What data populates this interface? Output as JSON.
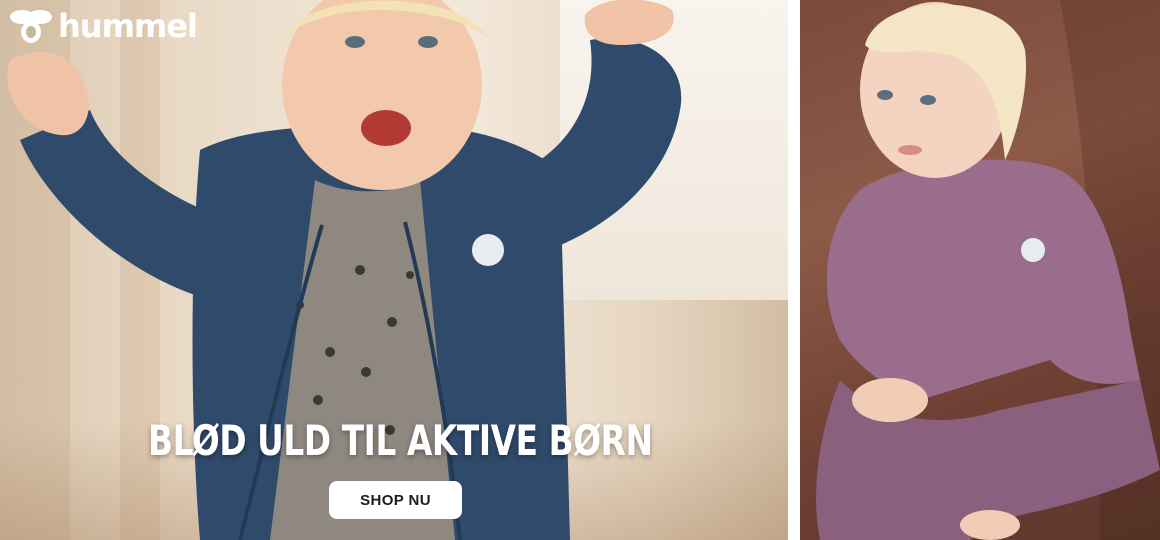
{
  "brand": {
    "name": "hummel"
  },
  "hero": {
    "headline": "BLØD ULD TIL AKTIVE BØRN",
    "cta_label": "SHOP NU"
  },
  "images": {
    "left": "toddler-in-navy-wool-cardigan-arms-raised",
    "right": "baby-in-dusty-purple-wool-set-sitting"
  },
  "colors": {
    "cta_background": "#ffffff",
    "headline": "#ffffff",
    "cardigan_navy": "#2f4a6b",
    "set_purple": "#9a6d8c"
  }
}
